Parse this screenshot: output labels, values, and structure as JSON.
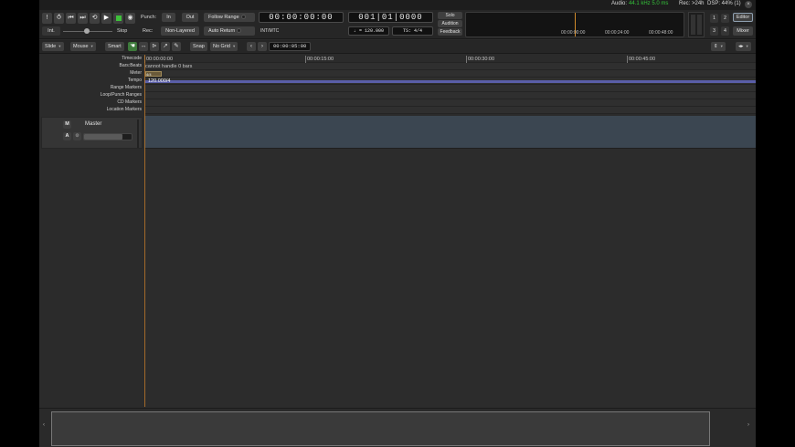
{
  "status": {
    "audio_label": "Audio:",
    "audio_value": "44.1 kHz 5.0 ms",
    "rec": "Rec: >24h",
    "dsp": "DSP: 44% (1)",
    "close": "×"
  },
  "transport": {
    "buttons": [
      {
        "name": "midi-panic-button",
        "glyph": "!"
      },
      {
        "name": "loop-button",
        "glyph": "⥀"
      },
      {
        "name": "goto-start-button",
        "glyph": "⏮"
      },
      {
        "name": "goto-end-button",
        "glyph": "⏭"
      },
      {
        "name": "loop-play-button",
        "glyph": "⟲"
      },
      {
        "name": "play-button",
        "glyph": "▶"
      },
      {
        "name": "stop-button",
        "glyph": ""
      },
      {
        "name": "record-button",
        "glyph": "◉"
      }
    ],
    "int_label": "Int.",
    "stop_label": "Stop"
  },
  "punch": {
    "label": "Punch:",
    "in_label": "In",
    "out_label": "Out",
    "rec_label": "Rec:",
    "rec_mode": "Non-Layered"
  },
  "follow": {
    "follow_range": "Follow Range",
    "auto_return": "Auto Return"
  },
  "clocks": {
    "primary": "00:00:00:00",
    "primary_sub": "INT/MTC",
    "secondary": "001|01|0000",
    "tempo": "♩ = 120.000",
    "meter": "TS: 4/4"
  },
  "monitor": {
    "solo": "Solo",
    "audition": "Audition",
    "feedback": "Feedback"
  },
  "minitimeline": {
    "ticks": [
      "00:00:00:00",
      "00:00:24:00",
      "00:00:48:00"
    ]
  },
  "window_buttons": {
    "editor": "Editor",
    "mixer": "Mixer",
    "num1": "1",
    "num2": "2",
    "num3": "3",
    "num4": "4"
  },
  "editbar": {
    "edit_mode": "Slide",
    "ripple": "Mouse",
    "smart": "Smart",
    "snap": "Snap",
    "grid": "No Grid",
    "nudge_clock": "00:00:05:00"
  },
  "rulers": {
    "labels": [
      "Timecode",
      "Bars:Beats",
      "Meter",
      "Tempo",
      "Range Markers",
      "Loop/Punch Ranges",
      "CD Markers",
      "Location Markers"
    ],
    "timecode_ticks": [
      "00:00:00:00",
      "00:00:15:00",
      "00:00:30:00",
      "00:00:45:00"
    ],
    "bbt_text": "cannot handle 0 bars",
    "meter_text": "4/4",
    "tempo_text": "120.000/4"
  },
  "master": {
    "name": "Master",
    "mute": "M",
    "auto": "A",
    "gain_fraction": 0.8
  },
  "colors": {
    "playhead": "#c07a2a",
    "tempo": "#5a5ea8",
    "master_track": "#3b4651",
    "stop_active": "#3ec03a",
    "smart_tool": "#3d7a3b",
    "audio_status": "#35c43a"
  }
}
